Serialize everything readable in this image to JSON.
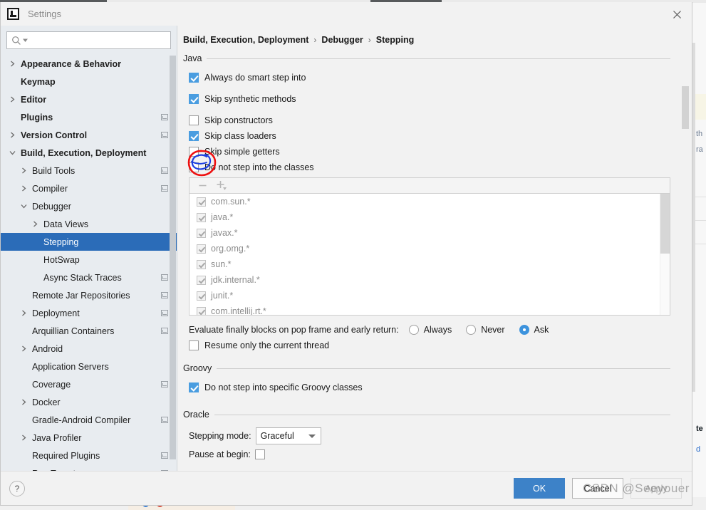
{
  "window": {
    "title": "Settings",
    "logo_icon": "intellij-idea-logo",
    "close_icon": "close-icon"
  },
  "search": {
    "placeholder": "",
    "value": "",
    "icon": "search-icon"
  },
  "sidebar": {
    "scrollbar": "vertical-scrollbar",
    "items": [
      {
        "label": "Appearance & Behavior",
        "indent": 0,
        "arrow": "chevron-right-icon",
        "bold": true,
        "badge": false,
        "selected": false
      },
      {
        "label": "Keymap",
        "indent": 0,
        "arrow": "none",
        "bold": true,
        "badge": false,
        "selected": false
      },
      {
        "label": "Editor",
        "indent": 0,
        "arrow": "chevron-right-icon",
        "bold": true,
        "badge": false,
        "selected": false
      },
      {
        "label": "Plugins",
        "indent": 0,
        "arrow": "none",
        "bold": true,
        "badge": true,
        "selected": false
      },
      {
        "label": "Version Control",
        "indent": 0,
        "arrow": "chevron-right-icon",
        "bold": true,
        "badge": true,
        "selected": false
      },
      {
        "label": "Build, Execution, Deployment",
        "indent": 0,
        "arrow": "chevron-down-icon",
        "bold": true,
        "badge": false,
        "selected": false
      },
      {
        "label": "Build Tools",
        "indent": 1,
        "arrow": "chevron-right-icon",
        "bold": false,
        "badge": true,
        "selected": false
      },
      {
        "label": "Compiler",
        "indent": 1,
        "arrow": "chevron-right-icon",
        "bold": false,
        "badge": true,
        "selected": false
      },
      {
        "label": "Debugger",
        "indent": 1,
        "arrow": "chevron-down-icon",
        "bold": false,
        "badge": false,
        "selected": false
      },
      {
        "label": "Data Views",
        "indent": 2,
        "arrow": "chevron-right-icon",
        "bold": false,
        "badge": false,
        "selected": false
      },
      {
        "label": "Stepping",
        "indent": 2,
        "arrow": "none",
        "bold": false,
        "badge": false,
        "selected": true
      },
      {
        "label": "HotSwap",
        "indent": 2,
        "arrow": "none",
        "bold": false,
        "badge": false,
        "selected": false
      },
      {
        "label": "Async Stack Traces",
        "indent": 2,
        "arrow": "none",
        "bold": false,
        "badge": true,
        "selected": false
      },
      {
        "label": "Remote Jar Repositories",
        "indent": 1,
        "arrow": "none",
        "bold": false,
        "badge": true,
        "selected": false
      },
      {
        "label": "Deployment",
        "indent": 1,
        "arrow": "chevron-right-icon",
        "bold": false,
        "badge": true,
        "selected": false
      },
      {
        "label": "Arquillian Containers",
        "indent": 1,
        "arrow": "none",
        "bold": false,
        "badge": true,
        "selected": false
      },
      {
        "label": "Android",
        "indent": 1,
        "arrow": "chevron-right-icon",
        "bold": false,
        "badge": false,
        "selected": false
      },
      {
        "label": "Application Servers",
        "indent": 1,
        "arrow": "none",
        "bold": false,
        "badge": false,
        "selected": false
      },
      {
        "label": "Coverage",
        "indent": 1,
        "arrow": "none",
        "bold": false,
        "badge": true,
        "selected": false
      },
      {
        "label": "Docker",
        "indent": 1,
        "arrow": "chevron-right-icon",
        "bold": false,
        "badge": false,
        "selected": false
      },
      {
        "label": "Gradle-Android Compiler",
        "indent": 1,
        "arrow": "none",
        "bold": false,
        "badge": true,
        "selected": false
      },
      {
        "label": "Java Profiler",
        "indent": 1,
        "arrow": "chevron-right-icon",
        "bold": false,
        "badge": false,
        "selected": false
      },
      {
        "label": "Required Plugins",
        "indent": 1,
        "arrow": "none",
        "bold": false,
        "badge": true,
        "selected": false
      },
      {
        "label": "Run Targets",
        "indent": 1,
        "arrow": "none",
        "bold": false,
        "badge": true,
        "selected": false
      }
    ]
  },
  "breadcrumb": {
    "parts": [
      "Build, Execution, Deployment",
      "Debugger",
      "Stepping"
    ],
    "separator": "›"
  },
  "java_section": {
    "title": "Java",
    "checkboxes": [
      {
        "label": "Always do smart step into",
        "checked": true,
        "mnemonic_index": 2
      },
      {
        "label": "Skip synthetic methods",
        "checked": true,
        "mnemonic_index": 7
      },
      {
        "label": "Skip constructors",
        "checked": false,
        "mnemonic_index": 5
      },
      {
        "label": "Skip class loaders",
        "checked": true,
        "mnemonic_index": 12
      },
      {
        "label": "Skip simple getters",
        "checked": false,
        "mnemonic_index": 12
      },
      {
        "label": "Do not step into the classes",
        "checked": false,
        "mnemonic_index": 16
      }
    ],
    "list_toolbar": {
      "remove_icon": "minus-icon",
      "add_icon": "plus-dropdown-icon"
    },
    "class_list": [
      {
        "pattern": "com.sun.*",
        "checked": true
      },
      {
        "pattern": "java.*",
        "checked": true
      },
      {
        "pattern": "javax.*",
        "checked": true
      },
      {
        "pattern": "org.omg.*",
        "checked": true
      },
      {
        "pattern": "sun.*",
        "checked": true
      },
      {
        "pattern": "jdk.internal.*",
        "checked": true
      },
      {
        "pattern": "junit.*",
        "checked": true
      },
      {
        "pattern": "com.intellij.rt.*",
        "checked": true
      }
    ],
    "finally_blocks": {
      "label": "Evaluate finally blocks on pop frame and early return:",
      "options": [
        {
          "label": "Always",
          "selected": false
        },
        {
          "label": "Never",
          "selected": false
        },
        {
          "label": "Ask",
          "selected": true
        }
      ]
    },
    "resume_thread": {
      "label": "Resume only the current thread",
      "checked": false
    }
  },
  "groovy_section": {
    "title": "Groovy",
    "checkbox": {
      "label": "Do not step into specific Groovy classes",
      "checked": true
    }
  },
  "oracle_section": {
    "title": "Oracle",
    "stepping_mode_label": "Stepping mode:",
    "stepping_mode_value": "Graceful",
    "stepping_mode_options": [
      "Graceful"
    ],
    "pause_at_begin_label": "Pause at begin:",
    "pause_at_begin_checked": false
  },
  "footer": {
    "help_label": "?",
    "ok_label": "OK",
    "cancel_label": "Cancel",
    "apply_label": "Apply"
  },
  "annotation": {
    "type": "hand-drawn-circle",
    "outer_color": "#ee1111",
    "inner_color": "#1c3fe0",
    "target": "Do not step into the classes checkbox"
  },
  "watermark": {
    "text": "CSDN @Seeyouer"
  },
  "background": {
    "fragments": [
      "th",
      "ra",
      "te",
      "d"
    ],
    "colors": {
      "accent": "#2b6cb8",
      "highlight": "#f7f5e6"
    }
  }
}
